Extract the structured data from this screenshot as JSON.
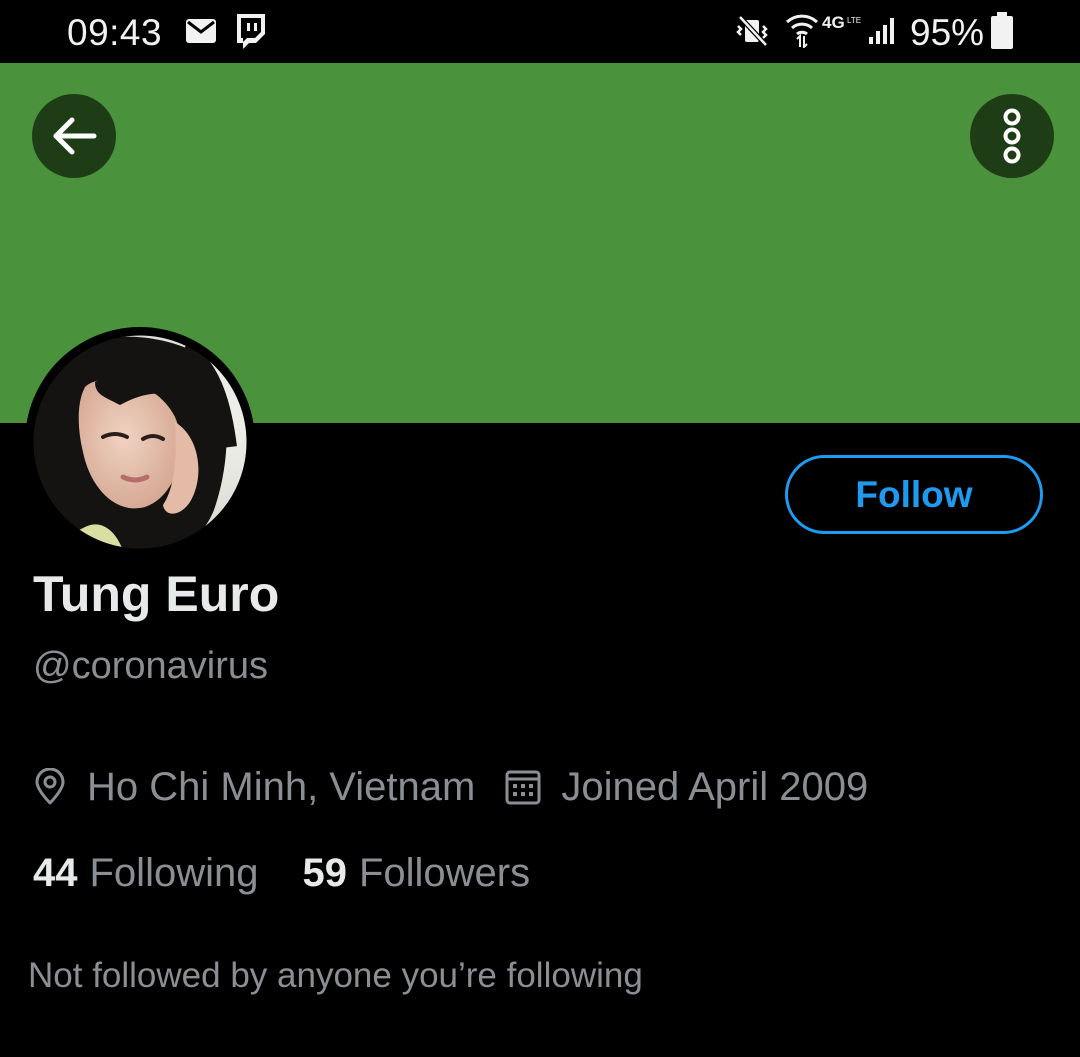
{
  "status_bar": {
    "time": "09:43",
    "battery_pct": "95%",
    "icons": [
      "email-icon",
      "twitch-icon",
      "mute-vibrate-icon",
      "wifi-icon",
      "4g-lte-icon",
      "signal-icon",
      "battery-icon"
    ]
  },
  "header": {
    "banner_color": "#4a923c",
    "back_icon": "arrow-left-icon",
    "more_icon": "more-vertical-icon"
  },
  "profile": {
    "display_name": "Tung Euro",
    "handle": "@coronavirus",
    "location": "Ho Chi Minh, Vietnam",
    "joined": "Joined April 2009",
    "following_count": "44",
    "following_label": "Following",
    "followers_count": "59",
    "followers_label": "Followers",
    "followed_by_text": "Not followed by anyone you’re following"
  },
  "actions": {
    "follow_label": "Follow",
    "accent_color": "#1d9bf0"
  }
}
